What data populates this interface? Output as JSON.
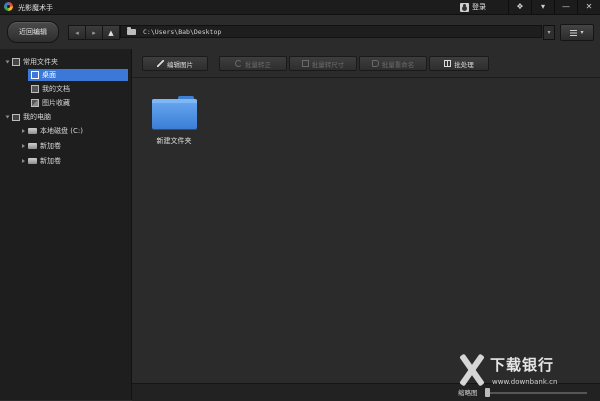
{
  "app": {
    "title": "光影魔术手",
    "login_label": "登录"
  },
  "window_controls": {
    "pin": "❖",
    "menu": "▾",
    "minimize": "—",
    "close": "✕"
  },
  "toolbar": {
    "recent_button": "近回编辑",
    "back": "◂",
    "forward": "▸",
    "up": "▲",
    "address": "C:\\Users\\Bab\\Desktop",
    "address_dropdown": "▾",
    "view_button_arrow": "▾"
  },
  "sidebar": {
    "favorites": "常用文件夹",
    "desktop": "桌面",
    "documents": "我的文档",
    "pictures": "图片收藏",
    "computer": "我的电脑",
    "drives": [
      "本地磁盘 (C:)",
      "新加卷",
      "新加卷"
    ]
  },
  "actions": {
    "edit": "编辑图片",
    "rotate": "批量转正",
    "resize": "批量转尺寸",
    "rename": "批量重命名",
    "batch": "批处理"
  },
  "files": [
    {
      "name": "新建文件夹"
    }
  ],
  "statusbar": {
    "thumb_label": "缩略图"
  },
  "watermark": {
    "title": "下载银行",
    "url": "www.downbank.cn"
  }
}
